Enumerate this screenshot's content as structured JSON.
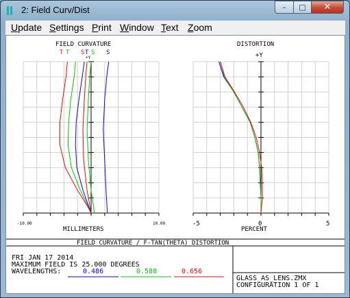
{
  "window": {
    "title": "2: Field Curv/Dist",
    "min_symbol": "–",
    "max_symbol": "□",
    "close_symbol": "✕"
  },
  "menu": [
    "Update",
    "Settings",
    "Print",
    "Window",
    "Text",
    "Zoom"
  ],
  "colors": {
    "blue": "#0000ff",
    "green": "#00c800",
    "red": "#ff0000"
  },
  "field_curvature": {
    "title": "FIELD CURVATURE",
    "axis_label": "+Y",
    "legend": {
      "red_t": "T",
      "green_t": "T",
      "blue_t": "T",
      "red_s": "S",
      "green_s": "S",
      "blue_s": "S"
    },
    "xlabel": "MILLIMETERS",
    "xticks": {
      "min": "-10.00",
      "max": "10.00"
    }
  },
  "distortion": {
    "title": "DISTORTION",
    "axis_label": "+Y",
    "xlabel": "PERCENT",
    "xticks": {
      "min": "-5",
      "mid": "0",
      "max": "5"
    }
  },
  "footer": {
    "caption": "FIELD CURVATURE / F-TAN(THETA) DISTORTION",
    "date": "FRI JAN 17 2014",
    "max_field": "MAXIMUM FIELD IS 25.000 DEGREES",
    "wavelengths_label": "WAVELENGTHS:",
    "wavelengths": [
      "0.486",
      "0.588",
      "0.656"
    ],
    "file": "GLASS_AS_LENS.ZMX",
    "configuration": "CONFIGURATION 1 OF 1"
  },
  "chart_data": [
    {
      "type": "line",
      "title": "FIELD CURVATURE",
      "xlabel": "MILLIMETERS",
      "ylabel": "+Y",
      "xlim": [
        -10,
        10
      ],
      "ylim": [
        0,
        1
      ],
      "grid": true,
      "series": [
        {
          "name": "T",
          "color": "red",
          "points": [
            [
              0,
              0
            ],
            [
              -0.6,
              0.05
            ],
            [
              -2.0,
              0.15
            ],
            [
              -3.8,
              0.3
            ],
            [
              -4.6,
              0.45
            ],
            [
              -4.6,
              0.6
            ],
            [
              -4.2,
              0.75
            ],
            [
              -3.7,
              0.9
            ],
            [
              -3.5,
              1.0
            ]
          ]
        },
        {
          "name": "T",
          "color": "green",
          "points": [
            [
              0,
              0
            ],
            [
              -0.5,
              0.05
            ],
            [
              -1.6,
              0.15
            ],
            [
              -2.9,
              0.3
            ],
            [
              -3.4,
              0.45
            ],
            [
              -3.3,
              0.6
            ],
            [
              -3.0,
              0.75
            ],
            [
              -2.5,
              0.9
            ],
            [
              -2.3,
              1.0
            ]
          ]
        },
        {
          "name": "T",
          "color": "blue",
          "points": [
            [
              0,
              0
            ],
            [
              -0.4,
              0.05
            ],
            [
              -1.2,
              0.15
            ],
            [
              -2.1,
              0.3
            ],
            [
              -2.3,
              0.45
            ],
            [
              -2.2,
              0.6
            ],
            [
              -1.8,
              0.75
            ],
            [
              -1.3,
              0.9
            ],
            [
              -1.0,
              1.0
            ]
          ]
        },
        {
          "name": "S",
          "color": "red",
          "points": [
            [
              0,
              0
            ],
            [
              -0.6,
              0.15
            ],
            [
              -1.1,
              0.35
            ],
            [
              -1.2,
              0.55
            ],
            [
              -1.0,
              0.75
            ],
            [
              -0.8,
              0.9
            ],
            [
              -0.6,
              1.0
            ]
          ]
        },
        {
          "name": "S",
          "color": "green",
          "points": [
            [
              0.5,
              0
            ],
            [
              0.0,
              0.15
            ],
            [
              -0.4,
              0.35
            ],
            [
              -0.6,
              0.55
            ],
            [
              -0.4,
              0.75
            ],
            [
              -0.2,
              0.9
            ],
            [
              0.0,
              1.0
            ]
          ]
        },
        {
          "name": "S",
          "color": "blue",
          "points": [
            [
              2.4,
              0
            ],
            [
              2.2,
              0.15
            ],
            [
              2.0,
              0.35
            ],
            [
              1.8,
              0.55
            ],
            [
              2.0,
              0.75
            ],
            [
              2.3,
              0.9
            ],
            [
              2.6,
              1.0
            ]
          ]
        }
      ]
    },
    {
      "type": "line",
      "title": "DISTORTION",
      "xlabel": "PERCENT",
      "ylabel": "+Y",
      "xlim": [
        -5,
        5
      ],
      "ylim": [
        0,
        1
      ],
      "grid": true,
      "series": [
        {
          "color": "blue",
          "points": [
            [
              0,
              0
            ],
            [
              0,
              0.1
            ],
            [
              -0.05,
              0.2
            ],
            [
              -0.1,
              0.3
            ],
            [
              -0.2,
              0.4
            ],
            [
              -0.45,
              0.5
            ],
            [
              -0.8,
              0.6
            ],
            [
              -1.4,
              0.7
            ],
            [
              -2.0,
              0.8
            ],
            [
              -2.75,
              0.9
            ],
            [
              -3.1,
              1.0
            ]
          ]
        },
        {
          "color": "green",
          "points": [
            [
              0,
              0
            ],
            [
              0,
              0.1
            ],
            [
              -0.05,
              0.2
            ],
            [
              -0.1,
              0.3
            ],
            [
              -0.2,
              0.4
            ],
            [
              -0.45,
              0.5
            ],
            [
              -0.8,
              0.6
            ],
            [
              -1.4,
              0.7
            ],
            [
              -2.0,
              0.8
            ],
            [
              -2.7,
              0.9
            ],
            [
              -3.0,
              1.0
            ]
          ]
        },
        {
          "color": "red",
          "points": [
            [
              0,
              0
            ],
            [
              0.1,
              0.1
            ],
            [
              0.1,
              0.2
            ],
            [
              0.05,
              0.3
            ],
            [
              -0.1,
              0.4
            ],
            [
              -0.35,
              0.5
            ],
            [
              -0.75,
              0.6
            ],
            [
              -1.3,
              0.7
            ],
            [
              -1.95,
              0.8
            ],
            [
              -2.65,
              0.9
            ],
            [
              -3.0,
              1.0
            ]
          ]
        }
      ]
    }
  ]
}
